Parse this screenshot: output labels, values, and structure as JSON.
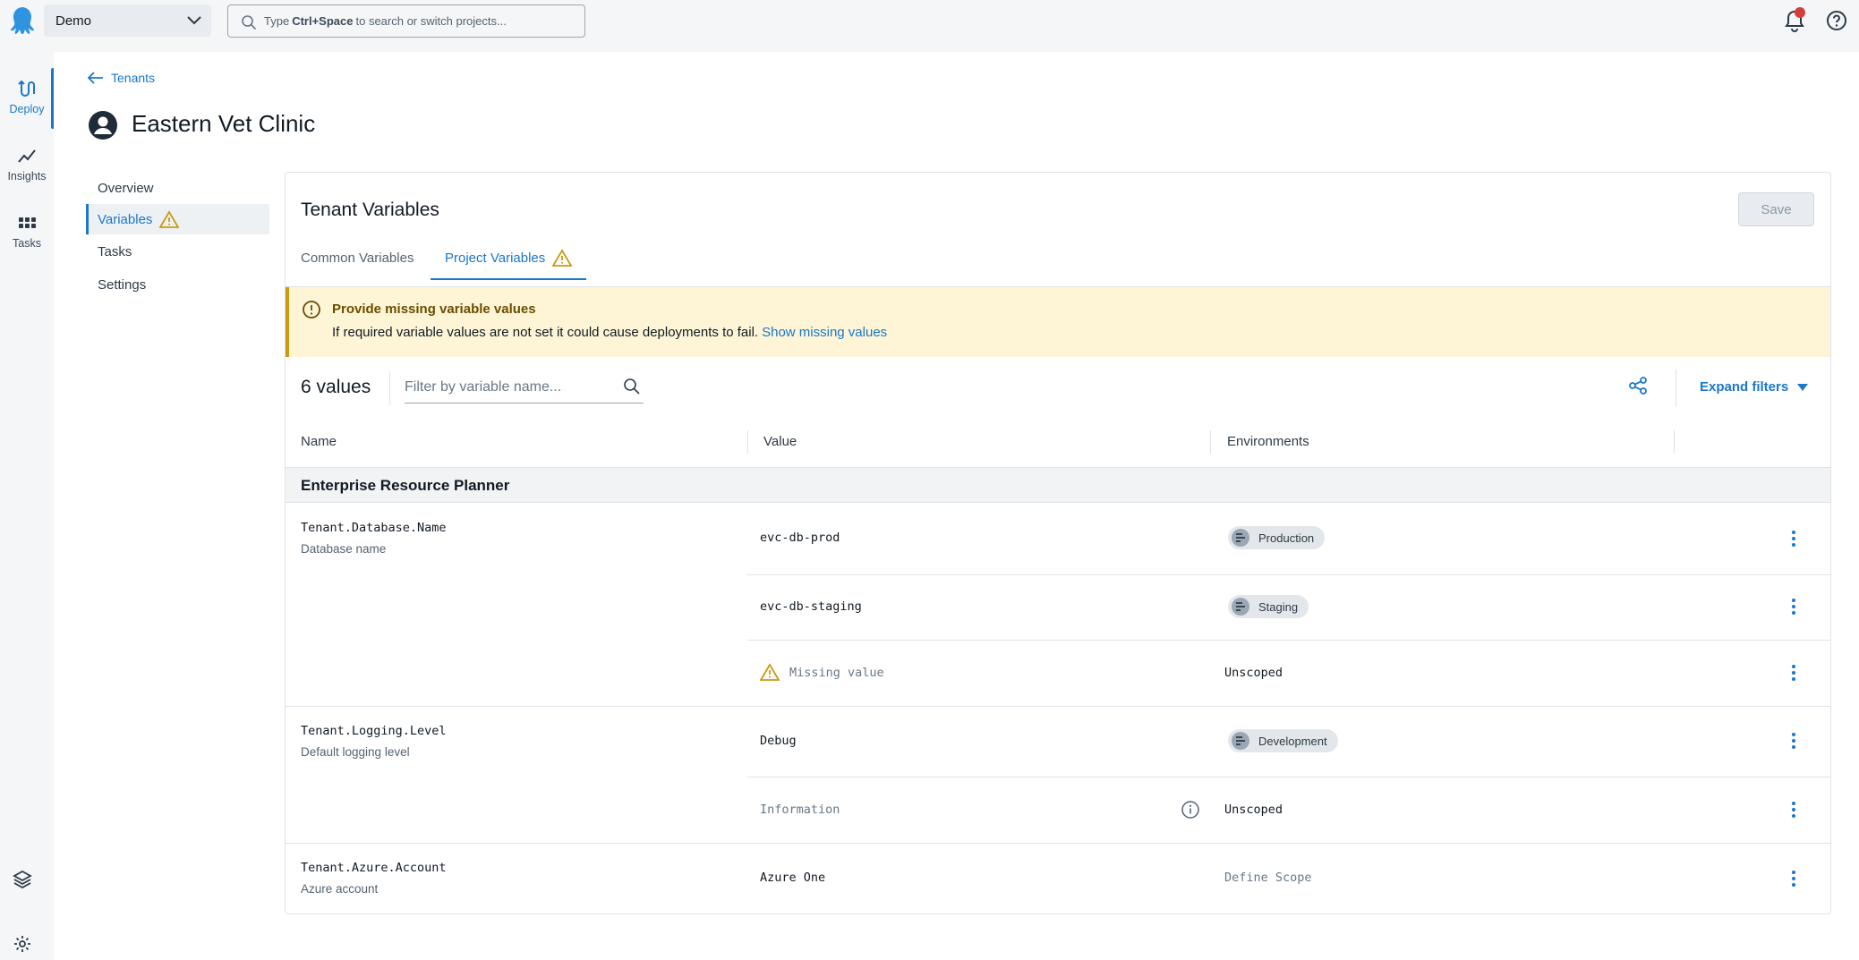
{
  "topbar": {
    "project": "Demo",
    "search_prefix": "Type",
    "search_shortcut": "Ctrl+Space",
    "search_suffix": "to search or switch projects..."
  },
  "leftnav": {
    "items": [
      {
        "label": "Deploy",
        "icon": "deploy-icon",
        "active": true
      },
      {
        "label": "Insights",
        "icon": "insights-icon"
      },
      {
        "label": "Tasks",
        "icon": "tasks-icon"
      }
    ]
  },
  "breadcrumb": "Tenants",
  "page_title": "Eastern Vet Clinic",
  "subnav": {
    "items": [
      {
        "label": "Overview"
      },
      {
        "label": "Variables",
        "active": true,
        "warning": true
      },
      {
        "label": "Tasks"
      },
      {
        "label": "Settings"
      }
    ]
  },
  "panel": {
    "title": "Tenant Variables",
    "save_label": "Save",
    "tabs": [
      {
        "label": "Common Variables"
      },
      {
        "label": "Project Variables",
        "active": true,
        "warning": true
      }
    ]
  },
  "callout": {
    "title": "Provide missing variable values",
    "body": "If required variable values are not set it could cause deployments to fail.",
    "link": "Show missing values"
  },
  "toolbar": {
    "count": "6 values",
    "filter_placeholder": "Filter by variable name...",
    "expand_filters": "Expand filters"
  },
  "table": {
    "headers": [
      "Name",
      "Value",
      "Environments"
    ],
    "group": "Enterprise Resource Planner",
    "rows": [
      {
        "name": "Tenant.Database.Name",
        "desc": "Database name",
        "value": "evc-db-prod",
        "env": "Production"
      },
      {
        "value": "evc-db-staging",
        "env": "Staging"
      },
      {
        "value": "Missing value",
        "scope": "Unscoped"
      },
      {
        "name": "Tenant.Logging.Level",
        "desc": "Default logging level",
        "value": "Debug",
        "env": "Development"
      },
      {
        "value": "Information",
        "scope": "Unscoped"
      },
      {
        "name": "Tenant.Azure.Account",
        "desc": "Azure account",
        "value": "Azure One",
        "scope": "Define Scope"
      }
    ]
  },
  "colors": {
    "accent": "#1a77ca",
    "warning": "#c99a12",
    "callout_bg": "#fdf5d6",
    "notification": "#d63d3d"
  }
}
